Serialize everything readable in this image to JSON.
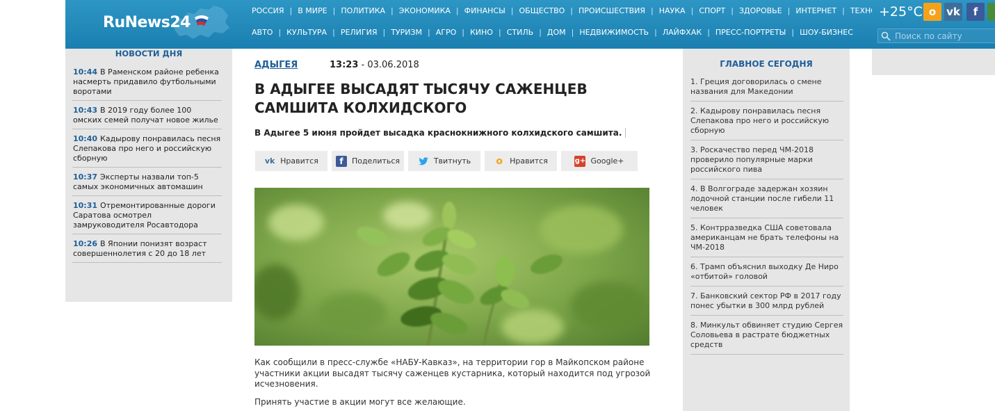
{
  "header": {
    "logo_text": "RuNews24",
    "nav_row1": [
      "Россия",
      "В мире",
      "Политика",
      "Экономика",
      "Финансы",
      "Общество",
      "Происшествия",
      "Наука",
      "Спорт",
      "Здоровье",
      "Интернет",
      "Технологии"
    ],
    "nav_row2": [
      "Авто",
      "Культура",
      "Религия",
      "Туризм",
      "Агро",
      "Кино",
      "Стиль",
      "Дом",
      "Недвижимость",
      "Лайфхак",
      "Пресс-портреты",
      "Шоу-бизнес"
    ],
    "weather": "+25°C",
    "search_placeholder": "Поиск по сайту",
    "social_icons": [
      "odnoklassniki-icon",
      "vk-icon",
      "facebook-icon"
    ]
  },
  "left_sidebar": {
    "title": "НОВОСТИ ДНЯ",
    "items": [
      {
        "time": "10:44",
        "text": "В Раменском районе ребенка насмерть придавило футбольными воротами"
      },
      {
        "time": "10:43",
        "text": "В 2019 году более 100 омских семей получат новое жилье"
      },
      {
        "time": "10:40",
        "text": "Кадырову понравилась песня Слепакова про него и российскую сборную"
      },
      {
        "time": "10:37",
        "text": "Эксперты назвали топ-5 самых экономичных автомашин"
      },
      {
        "time": "10:31",
        "text": "Отремонтированные дороги Саратова осмотрел замруководителя Росавтодора"
      },
      {
        "time": "10:26",
        "text": "В Японии понизят возраст совершеннолетия с 20 до 18 лет"
      }
    ]
  },
  "article": {
    "rubric": "АДЫГЕЯ",
    "time": "13:23",
    "date": " - 03.06.2018",
    "title": "В Адыгее высадят тысячу саженцев самшита колхидского",
    "lead": "В Адыгее 5 июня пройдет высадка краснокнижного колхидского самшита.",
    "share": [
      {
        "label": "Нравится",
        "icon": "vk-icon"
      },
      {
        "label": "Поделиться",
        "icon": "facebook-icon"
      },
      {
        "label": "Твитнуть",
        "icon": "twitter-icon"
      },
      {
        "label": "Нравится",
        "icon": "odnoklassniki-icon"
      },
      {
        "label": "Google+",
        "icon": "google-plus-icon"
      }
    ],
    "paragraphs": [
      "Как сообщили в пресс-службе «НАБУ-Кавказ», на территории гор в Майкопском районе участники акции высадят тысячу саженцев кустарника, который находится под угрозой исчезновения.",
      "Принять участие в акции могут все желающие."
    ]
  },
  "right_sidebar": {
    "title": "ГЛАВНОЕ СЕГОДНЯ",
    "items": [
      "1. Греция договорилась о смене названия для Македонии",
      "2. Кадырову понравилась песня Слепакова про него и российскую сборную",
      "3. Роскачество перед ЧМ-2018 проверило популярные марки российского пива",
      "4. В Волгограде задержан хозяин лодочной станции после гибели 11 человек",
      "5. Контрразведка США советовала американцам не брать телефоны на ЧМ-2018",
      "6. Трамп объяснил выходку Де Ниро «отбитой» головой",
      "7. Банковский сектор РФ в 2017 году понес убытки в 300 млрд рублей",
      "8. Минкульт обвиняет студию Сергея Соловьева в растрате бюджетных средств"
    ]
  },
  "colors": {
    "header_blue": "#1f88ba",
    "link_blue": "#1f5f9a",
    "sidebar_gray": "#e6e6e6"
  }
}
